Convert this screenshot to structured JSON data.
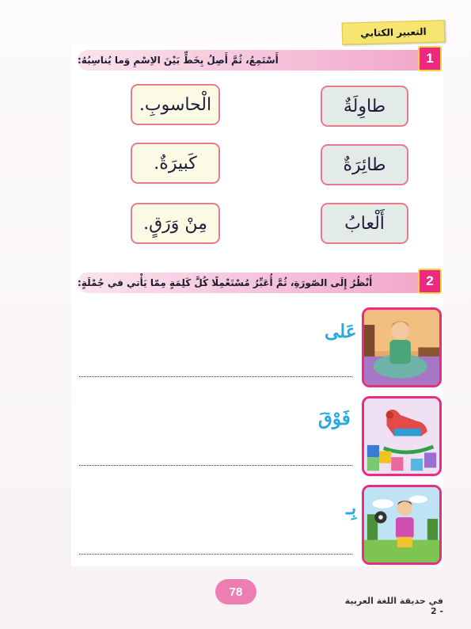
{
  "section": {
    "title": "التعبير الكتابي"
  },
  "exercise1": {
    "number": "1",
    "instruction": "أَسْتَمِعُ، ثُمَّ أَصِلُ بِخَطٍّ بَيْنَ الاِسْمِ وَما يُناسِبُهُ:",
    "nouns": [
      "طاوِلَةٌ",
      "طائِرَةٌ",
      "أَلْعابُ"
    ],
    "descriptions": [
      "الْحاسوبِ.",
      "كَبيرَةٌ.",
      "مِنْ وَرَقٍ."
    ]
  },
  "exercise2": {
    "number": "2",
    "instruction": "أَنْظُرُ إِلَى الصّورَةِ، ثُمَّ أُعَبِّرُ مُسْتَعْمِلًا كُلَّ كَلِمَةٍ مِمّا يَأْتي في جُمْلَةٍ:",
    "items": [
      {
        "word": "عَلى",
        "image": "boy-sitting-on-bed"
      },
      {
        "word": "فَوْقَ",
        "image": "rocking-horse-on-blocks"
      },
      {
        "word": "بِـ",
        "image": "boy-playing-with-ball"
      }
    ]
  },
  "footer": {
    "page_number": "78",
    "book_title": "في حديقة اللغة العربية - 2"
  },
  "colors": {
    "accent": "#ec2a7f",
    "keyword": "#2aa8e0",
    "tag": "#f6e571"
  }
}
